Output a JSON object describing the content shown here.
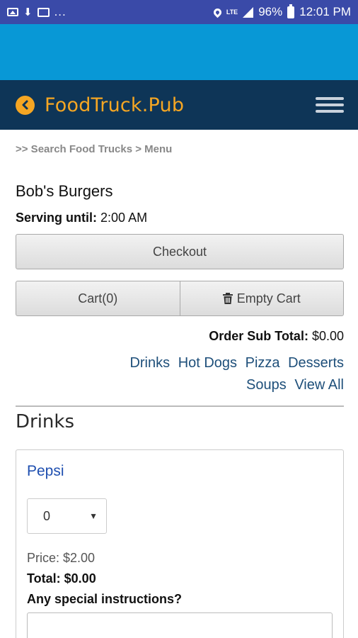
{
  "status_bar": {
    "overflow": "...",
    "network": "LTE",
    "battery": "96%",
    "time": "12:01 PM"
  },
  "header": {
    "title": "FoodTruck.Pub",
    "accent_color": "#f5a623",
    "background_color": "#0e3557"
  },
  "breadcrumb": ">> Search Food Trucks > Menu",
  "truck": {
    "name": "Bob's Burgers",
    "serving_label": "Serving until:",
    "serving_time": "2:00 AM"
  },
  "buttons": {
    "checkout": "Checkout",
    "cart": "Cart(0)",
    "empty_cart": "Empty Cart"
  },
  "order": {
    "subtotal_label": "Order Sub Total:",
    "subtotal_value": "$0.00"
  },
  "categories": [
    "Drinks",
    "Hot Dogs",
    "Pizza",
    "Desserts",
    "Soups",
    "View All"
  ],
  "section": {
    "title": "Drinks"
  },
  "item": {
    "name": "Pepsi",
    "quantity": "0",
    "price": "Price: $2.00",
    "total": "Total: $0.00",
    "instructions_label": "Any special instructions?"
  }
}
